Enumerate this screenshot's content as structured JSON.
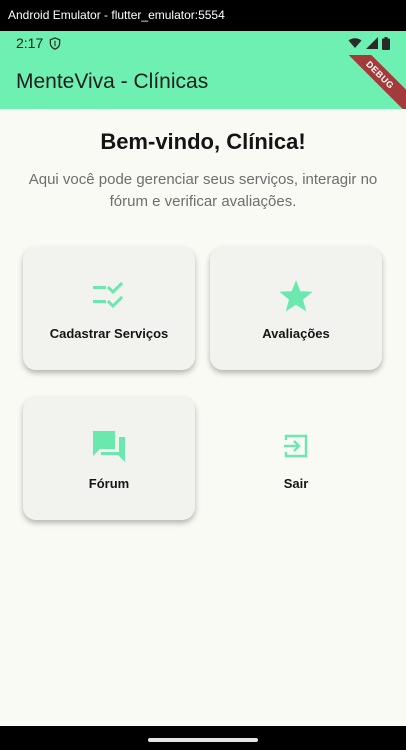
{
  "window": {
    "title": "Android Emulator - flutter_emulator:5554"
  },
  "status_bar": {
    "time": "2:17",
    "left_icon": "shield-icon",
    "right_icons": [
      "wifi-icon",
      "signal-icon",
      "battery-icon"
    ]
  },
  "app_bar": {
    "title": "MenteViva - Clínicas",
    "debug_banner": "DEBUG",
    "color": "#6df0b2"
  },
  "welcome": {
    "title": "Bem-vindo, Clínica!",
    "subtitle": "Aqui você pode gerenciar seus serviços, interagir no fórum e verificar avaliações."
  },
  "menu": {
    "items": [
      {
        "label": "Cadastrar Serviços",
        "icon": "checklist-icon"
      },
      {
        "label": "Avaliações",
        "icon": "star-icon"
      },
      {
        "label": "Fórum",
        "icon": "forum-icon"
      },
      {
        "label": "Sair",
        "icon": "exit-icon"
      }
    ],
    "accent_color": "#6be8ad"
  }
}
